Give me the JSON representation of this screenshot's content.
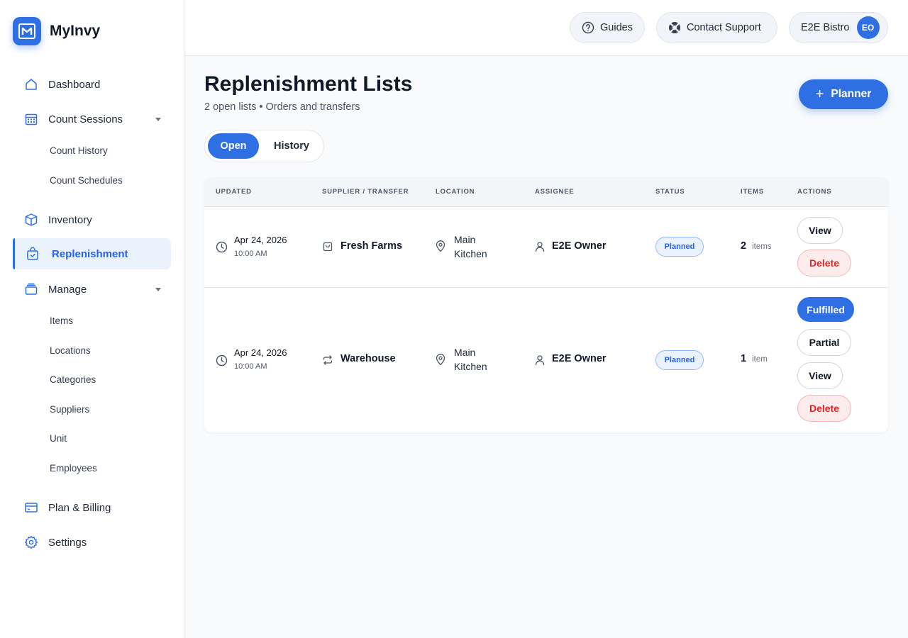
{
  "brand": {
    "name": "MyInvy"
  },
  "sidebar": {
    "items": [
      {
        "label": "Dashboard",
        "icon": "home-icon"
      },
      {
        "label": "Count Sessions",
        "icon": "calendar-icon",
        "sub": [
          "Count History",
          "Count Schedules"
        ]
      },
      {
        "label": "Inventory",
        "icon": "box-icon"
      },
      {
        "label": "Replenishment",
        "icon": "shopping-bag-icon",
        "active": true
      },
      {
        "label": "Manage",
        "icon": "layers-icon",
        "sub": [
          "Items",
          "Locations",
          "Categories",
          "Suppliers",
          "Unit",
          "Employees"
        ]
      },
      {
        "label": "Plan & Billing",
        "icon": "credit-card-icon"
      },
      {
        "label": "Settings",
        "icon": "gear-icon"
      }
    ]
  },
  "header": {
    "guides": "Guides",
    "support": "Contact Support",
    "org": "E2E Bistro",
    "avatar_initials": "EO"
  },
  "main": {
    "title": "Replenishment Lists",
    "subtitle": "2 open lists • Orders and transfers",
    "planner_button": "Planner",
    "tabs": [
      {
        "label": "Open",
        "active": true
      },
      {
        "label": "History",
        "active": false
      }
    ],
    "table": {
      "columns": [
        "UPDATED",
        "SUPPLIER / TRANSFER",
        "LOCATION",
        "ASSIGNEE",
        "STATUS",
        "ITEMS",
        "ACTIONS"
      ],
      "rows": [
        {
          "date": "Apr 24, 2026",
          "time": "10:00 AM",
          "source": "Fresh Farms",
          "source_icon": "shopping-bag-icon",
          "location_line1": "Main",
          "location_line2": "Kitchen",
          "assignee": "E2E Owner",
          "status": "Planned",
          "items_count": "2",
          "items_unit": "items",
          "actions": [
            "View",
            "Delete"
          ]
        },
        {
          "date": "Apr 24, 2026",
          "time": "10:00 AM",
          "source": "Warehouse",
          "source_icon": "transfer-arrows-icon",
          "location_line1": "Main",
          "location_line2": "Kitchen",
          "assignee": "E2E Owner",
          "status": "Planned",
          "items_count": "1",
          "items_unit": "item",
          "actions": [
            "Fulfilled",
            "Partial",
            "View",
            "Delete"
          ]
        }
      ]
    }
  },
  "colors": {
    "accent": "#2f6fe4",
    "danger": "#dc2626",
    "active_bg": "#eaf2fe"
  }
}
